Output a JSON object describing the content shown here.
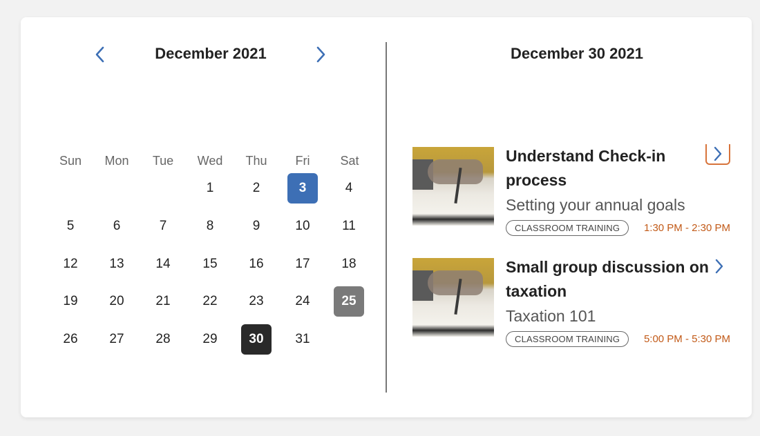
{
  "calendar": {
    "month_title": "December 2021",
    "weekdays": [
      "Sun",
      "Mon",
      "Tue",
      "Wed",
      "Thu",
      "Fri",
      "Sat"
    ],
    "weeks": [
      [
        "",
        "",
        "",
        "1",
        "2",
        "3",
        "4"
      ],
      [
        "5",
        "6",
        "7",
        "8",
        "9",
        "10",
        "11"
      ],
      [
        "12",
        "13",
        "14",
        "15",
        "16",
        "17",
        "18"
      ],
      [
        "19",
        "20",
        "21",
        "22",
        "23",
        "24",
        "25"
      ],
      [
        "26",
        "27",
        "28",
        "29",
        "30",
        "31",
        ""
      ]
    ],
    "highlight_blue_day": "3",
    "highlight_grey_day": "25",
    "selected_day": "30"
  },
  "agenda": {
    "date_title": "December 30 2021",
    "events": [
      {
        "title": "Understand Check-in process",
        "subtitle": "Setting your annual goals",
        "tag": "CLASSROOM TRAINING",
        "time": "1:30 PM - 2:30 PM"
      },
      {
        "title": "Small group discussion on taxation",
        "subtitle": "Taxation 101",
        "tag": "CLASSROOM TRAINING",
        "time": "5:00 PM - 5:30 PM"
      }
    ]
  },
  "colors": {
    "accent_blue": "#3d6fb5",
    "accent_orange": "#c25a18",
    "selected_dark": "#2a2a2a",
    "grey_highlight": "#7a7a7a"
  },
  "icons": {
    "prev": "chevron-left-icon",
    "next": "chevron-right-icon",
    "event_open": "chevron-right-icon"
  }
}
